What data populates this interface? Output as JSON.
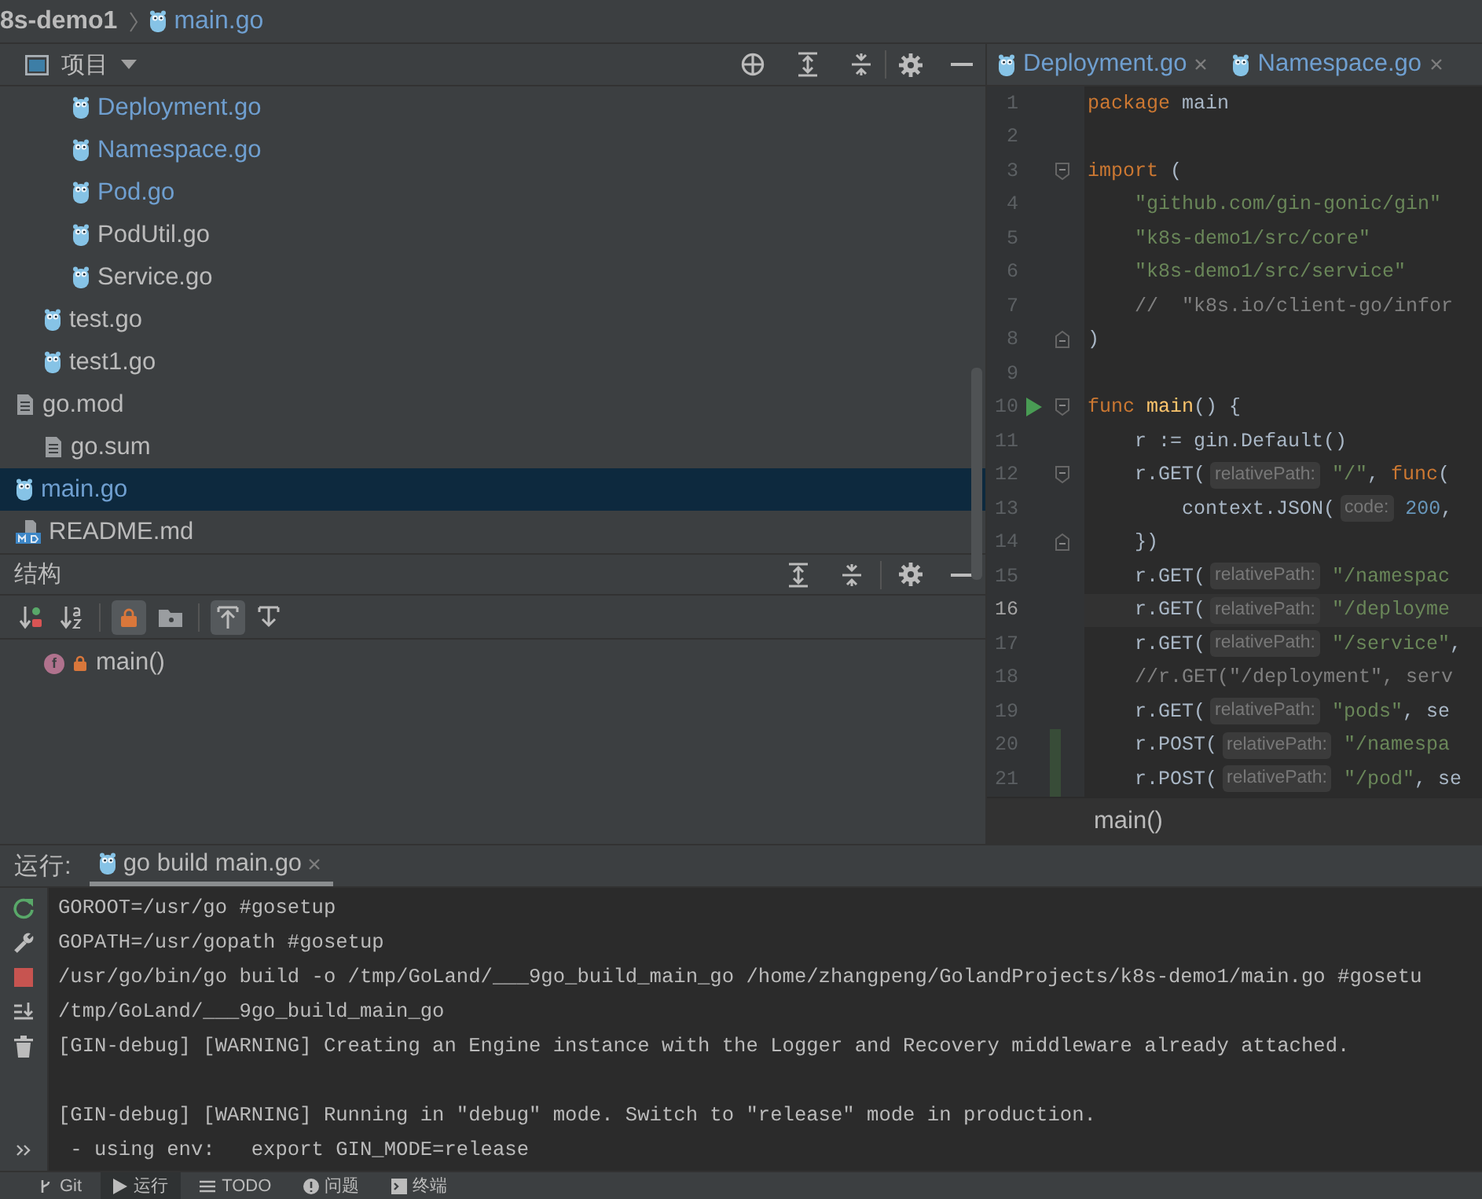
{
  "breadcrumb": [
    {
      "kind": "project",
      "label": "8s-demo1"
    },
    {
      "kind": "go",
      "label": "main.go"
    }
  ],
  "project_panel": {
    "title": "项目",
    "tree": [
      {
        "children": [
          {
            "children": [
              {
                "label": "Deployment.go",
                "kind": "go",
                "modified": true,
                "selected": false
              },
              {
                "label": "Namespace.go",
                "kind": "go",
                "modified": true,
                "selected": false
              },
              {
                "label": "Pod.go",
                "kind": "go",
                "modified": true,
                "selected": false
              },
              {
                "label": "PodUtil.go",
                "kind": "go",
                "modified": false,
                "selected": false
              },
              {
                "label": "Service.go",
                "kind": "go",
                "modified": false,
                "selected": false
              }
            ]
          },
          {
            "label": "test.go",
            "kind": "go",
            "modified": false,
            "selected": false
          },
          {
            "label": "test1.go",
            "kind": "go",
            "modified": false,
            "selected": false
          }
        ]
      },
      {
        "label": "go.mod",
        "kind": "text",
        "modified": false,
        "selected": false,
        "expanded": true,
        "children": [
          {
            "label": "go.sum",
            "kind": "text",
            "modified": false,
            "selected": false
          }
        ]
      },
      {
        "label": "main.go",
        "kind": "go",
        "modified": true,
        "selected": true
      },
      {
        "label": "README.md",
        "kind": "markdown",
        "modified": false,
        "selected": false
      }
    ]
  },
  "structure_panel": {
    "title": "结构",
    "toolbar": [
      {
        "kind": "sort-visibility",
        "on": false,
        "separator_before": false
      },
      {
        "kind": "sort-alpha",
        "on": false,
        "separator_before": false
      },
      {
        "kind": "show-private",
        "on": true,
        "separator_before": true
      },
      {
        "kind": "show-folder",
        "on": false,
        "separator_before": false
      },
      {
        "kind": "scroll-from",
        "on": true,
        "separator_before": true
      },
      {
        "kind": "scroll-to",
        "on": false,
        "separator_before": false
      }
    ],
    "items": [
      {
        "label": "main()",
        "icon_letter": "f",
        "private": true,
        "selected": false
      }
    ]
  },
  "editor": {
    "tabs": [
      {
        "label": "Deployment.go",
        "selected": false
      },
      {
        "label": "Namespace.go",
        "selected": false
      }
    ],
    "lines": [
      {
        "number": "1",
        "current": false,
        "changed": false,
        "tokens": [
          {
            "kind": "keyword",
            "text": "package"
          },
          {
            "kind": "plain",
            "text": " main"
          }
        ]
      },
      {
        "number": "2",
        "current": false,
        "changed": false
      },
      {
        "number": "3",
        "current": false,
        "changed": false,
        "fold_start": true,
        "tokens": [
          {
            "kind": "keyword",
            "text": "import"
          },
          {
            "kind": "plain",
            "text": " ("
          }
        ]
      },
      {
        "number": "4",
        "current": false,
        "changed": false,
        "tokens": [
          {
            "kind": "string",
            "text": "    \"github.com/gin-gonic/gin\""
          }
        ]
      },
      {
        "number": "5",
        "current": false,
        "changed": false,
        "tokens": [
          {
            "kind": "string",
            "text": "    \"k8s-demo1/src/core\""
          }
        ]
      },
      {
        "number": "6",
        "current": false,
        "changed": false,
        "tokens": [
          {
            "kind": "string",
            "text": "    \"k8s-demo1/src/service\""
          }
        ]
      },
      {
        "number": "7",
        "current": false,
        "changed": false,
        "tokens": [
          {
            "kind": "comment",
            "text": "    //  \"k8s.io/client-go/infor"
          }
        ]
      },
      {
        "number": "8",
        "current": false,
        "changed": false,
        "fold_end": true,
        "tokens": [
          {
            "kind": "plain",
            "text": ")"
          }
        ]
      },
      {
        "number": "9",
        "current": false,
        "changed": false
      },
      {
        "number": "10",
        "current": false,
        "changed": false,
        "run": true,
        "fold_start": true,
        "tokens": [
          {
            "kind": "keyword",
            "text": "func"
          },
          {
            "kind": "function",
            "text": " main"
          },
          {
            "kind": "plain",
            "text": "() {"
          }
        ]
      },
      {
        "number": "11",
        "current": false,
        "changed": false,
        "tokens": [
          {
            "kind": "plain",
            "text": "    r := gin.Default()"
          }
        ]
      },
      {
        "number": "12",
        "current": false,
        "changed": false,
        "fold_start": true,
        "tokens": [
          {
            "kind": "plain",
            "text": "    r.GET("
          },
          {
            "kind": "hint",
            "text": "relativePath:"
          },
          {
            "kind": "string",
            "text": " \"/\""
          },
          {
            "kind": "plain",
            "text": ", "
          },
          {
            "kind": "keyword",
            "text": "func"
          },
          {
            "kind": "plain",
            "text": "("
          }
        ]
      },
      {
        "number": "13",
        "current": false,
        "changed": false,
        "tokens": [
          {
            "kind": "plain",
            "text": "        context.JSON("
          },
          {
            "kind": "hint",
            "text": "code:"
          },
          {
            "kind": "number",
            "text": " 200"
          },
          {
            "kind": "plain",
            "text": ","
          }
        ]
      },
      {
        "number": "14",
        "current": false,
        "changed": false,
        "fold_end": true,
        "tokens": [
          {
            "kind": "plain",
            "text": "    })"
          }
        ]
      },
      {
        "number": "15",
        "current": false,
        "changed": false,
        "tokens": [
          {
            "kind": "plain",
            "text": "    r.GET("
          },
          {
            "kind": "hint",
            "text": "relativePath:"
          },
          {
            "kind": "string",
            "text": " \"/namespac"
          }
        ]
      },
      {
        "number": "16",
        "current": true,
        "changed": false,
        "tokens": [
          {
            "kind": "plain",
            "text": "    r.GET("
          },
          {
            "kind": "hint",
            "text": "relativePath:"
          },
          {
            "kind": "string",
            "text": " \"/deployme"
          }
        ]
      },
      {
        "number": "17",
        "current": false,
        "changed": false,
        "tokens": [
          {
            "kind": "plain",
            "text": "    r.GET("
          },
          {
            "kind": "hint",
            "text": "relativePath:"
          },
          {
            "kind": "string",
            "text": " \"/service\""
          },
          {
            "kind": "plain",
            "text": ","
          }
        ]
      },
      {
        "number": "18",
        "current": false,
        "changed": false,
        "tokens": [
          {
            "kind": "comment",
            "text": "    //r.GET(\"/deployment\", serv"
          }
        ]
      },
      {
        "number": "19",
        "current": false,
        "changed": false,
        "tokens": [
          {
            "kind": "plain",
            "text": "    r.GET("
          },
          {
            "kind": "hint",
            "text": "relativePath:"
          },
          {
            "kind": "string",
            "text": " \"pods\""
          },
          {
            "kind": "plain",
            "text": ", se"
          }
        ]
      },
      {
        "number": "20",
        "current": false,
        "changed": true,
        "tokens": [
          {
            "kind": "plain",
            "text": "    r.POST("
          },
          {
            "kind": "hint",
            "text": "relativePath:"
          },
          {
            "kind": "string",
            "text": " \"/namespa"
          }
        ]
      },
      {
        "number": "21",
        "current": false,
        "changed": true,
        "tokens": [
          {
            "kind": "plain",
            "text": "    r.POST("
          },
          {
            "kind": "hint",
            "text": "relativePath:"
          },
          {
            "kind": "string",
            "text": " \"/pod\""
          },
          {
            "kind": "plain",
            "text": ", se"
          }
        ]
      }
    ],
    "footer": "main()"
  },
  "run_panel": {
    "label": "运行:",
    "tabs": [
      {
        "label": "go build main.go",
        "selected": true
      }
    ],
    "tools": [
      {
        "kind": "rerun"
      },
      {
        "kind": "wrench"
      },
      {
        "kind": "stop"
      },
      {
        "kind": "scroll-end"
      },
      {
        "kind": "trash"
      },
      {
        "kind": "more"
      }
    ],
    "console": [
      {
        "kind": "output",
        "text": "GOROOT=/usr/go #gosetup"
      },
      {
        "kind": "output",
        "text": "GOPATH=/usr/gopath #gosetup"
      },
      {
        "kind": "output",
        "text": "/usr/go/bin/go build -o /tmp/GoLand/___9go_build_main_go /home/zhangpeng/GolandProjects/k8s-demo1/main.go #gosetu"
      },
      {
        "kind": "output",
        "text": "/tmp/GoLand/___9go_build_main_go"
      },
      {
        "kind": "output",
        "text": "[GIN-debug] [WARNING] Creating an Engine instance with the Logger and Recovery middleware already attached."
      },
      {
        "kind": "blank"
      },
      {
        "kind": "output",
        "text": "[GIN-debug] [WARNING] Running in \"debug\" mode. Switch to \"release\" mode in production."
      },
      {
        "kind": "output",
        "text": " - using env:   export GIN_MODE=release"
      }
    ]
  },
  "tool_strip": [
    {
      "kind": "git",
      "label": "Git",
      "selected": false
    },
    {
      "kind": "run",
      "label": "运行",
      "selected": true
    },
    {
      "kind": "todo",
      "label": "TODO",
      "selected": false
    },
    {
      "kind": "problems",
      "label": "问题",
      "selected": false
    },
    {
      "kind": "terminal",
      "label": "终端",
      "selected": false
    }
  ]
}
